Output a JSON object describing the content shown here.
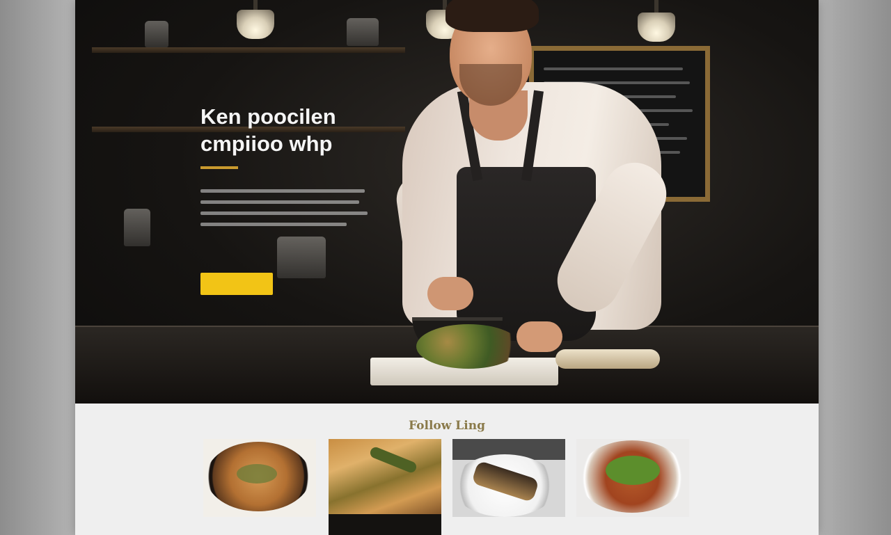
{
  "hero": {
    "title_line1": "Ken poocilen",
    "title_line2": "cmpiioo whp",
    "button_label": ""
  },
  "follow": {
    "title": "Follow Ling",
    "thumbnails": [
      {
        "alt": "dish-1"
      },
      {
        "alt": "dish-2"
      },
      {
        "alt": "dish-3"
      },
      {
        "alt": "dish-4"
      }
    ]
  },
  "colors": {
    "accent_yellow": "#f2c416",
    "underline_gold": "#c99a2e",
    "hero_background": "#161412",
    "section_background": "#efefef"
  }
}
